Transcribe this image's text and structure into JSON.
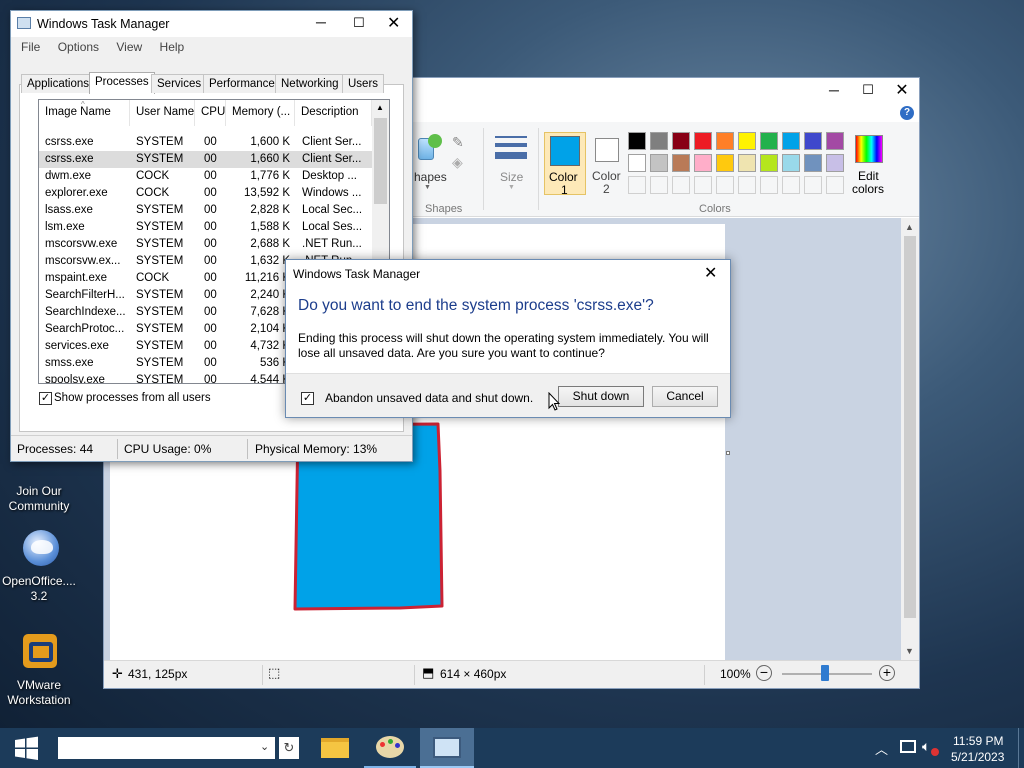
{
  "desktop": {
    "icons": [
      {
        "label_line1": "Join Our",
        "label_line2": "Community",
        "icon": "community-icon"
      },
      {
        "label_line1": "OpenOffice....",
        "label_line2": "3.2",
        "icon": "openoffice-icon"
      },
      {
        "label_line1": "VMware",
        "label_line2": "Workstation",
        "icon": "vmware-icon"
      }
    ]
  },
  "paint": {
    "ribbon": {
      "shapes_label": "hapes",
      "shapes_group": "Shapes",
      "size_label": "Size",
      "color1_line1": "Color",
      "color1_line2": "1",
      "color2_line1": "Color",
      "color2_line2": "2",
      "edit_line1": "Edit",
      "edit_line2": "colors",
      "colors_group": "Colors"
    },
    "palette_row1": [
      "#000000",
      "#7f7f7f",
      "#880015",
      "#ed1c24",
      "#ff7f27",
      "#fff200",
      "#22b14c",
      "#00a2e8",
      "#3f48cc",
      "#a349a4"
    ],
    "palette_row2": [
      "#ffffff",
      "#c3c3c3",
      "#b97a57",
      "#ffaec9",
      "#ffc90e",
      "#efe4b0",
      "#b5e61d",
      "#99d9ea",
      "#7092be",
      "#c8bfe7"
    ],
    "color1": "#00a2e8",
    "color2": "#ffffff",
    "status": {
      "cursor_pos": "431, 125px",
      "canvas_size": "614 × 460px",
      "zoom": "100%"
    },
    "zoom_level_percent": 100
  },
  "taskmanager": {
    "title": "Windows Task Manager",
    "menu": [
      "File",
      "Options",
      "View",
      "Help"
    ],
    "tabs": [
      "Applications",
      "Processes",
      "Services",
      "Performance",
      "Networking",
      "Users"
    ],
    "active_tab": "Processes",
    "columns": [
      "Image Name",
      "User Name",
      "CPU",
      "Memory (...",
      "Description"
    ],
    "rows": [
      [
        "csrss.exe",
        "SYSTEM",
        "00",
        "1,600 K",
        "Client Ser..."
      ],
      [
        "csrss.exe",
        "SYSTEM",
        "00",
        "1,660 K",
        "Client Ser..."
      ],
      [
        "dwm.exe",
        "COCK",
        "00",
        "1,776 K",
        "Desktop ..."
      ],
      [
        "explorer.exe",
        "COCK",
        "00",
        "13,592 K",
        "Windows ..."
      ],
      [
        "lsass.exe",
        "SYSTEM",
        "00",
        "2,828 K",
        "Local Sec..."
      ],
      [
        "lsm.exe",
        "SYSTEM",
        "00",
        "1,588 K",
        "Local Ses..."
      ],
      [
        "mscorsvw.exe",
        "SYSTEM",
        "00",
        "2,688 K",
        ".NET Run..."
      ],
      [
        "mscorsvw.ex...",
        "SYSTEM",
        "00",
        "1,632 K",
        ".NET Run..."
      ],
      [
        "mspaint.exe",
        "COCK",
        "00",
        "11,216 K",
        ""
      ],
      [
        "SearchFilterH...",
        "SYSTEM",
        "00",
        "2,240 K",
        ""
      ],
      [
        "SearchIndexe...",
        "SYSTEM",
        "00",
        "7,628 K",
        ""
      ],
      [
        "SearchProtoc...",
        "SYSTEM",
        "00",
        "2,104 K",
        ""
      ],
      [
        "services.exe",
        "SYSTEM",
        "00",
        "4,732 K",
        ""
      ],
      [
        "smss.exe",
        "SYSTEM",
        "00",
        "536 K",
        ""
      ],
      [
        "spoolsv.exe",
        "SYSTEM",
        "00",
        "4,544 K",
        ""
      ]
    ],
    "selected_row": 1,
    "show_all_label": "Show processes from all users",
    "status": {
      "processes": "Processes: 44",
      "cpu": "CPU Usage: 0%",
      "memory": "Physical Memory: 13%"
    }
  },
  "dialog": {
    "title": "Windows Task Manager",
    "heading": "Do you want to end the system process 'csrss.exe'?",
    "body_line1": "Ending this process will shut down the operating system immediately.  You will",
    "body_line2": "lose all unsaved data.  Are you sure you want to continue?",
    "checkbox_label": "Abandon unsaved data and shut down.",
    "checkbox_checked": true,
    "shutdown_label": "Shut down",
    "cancel_label": "Cancel"
  },
  "taskbar": {
    "time": "11:59 PM",
    "date": "5/21/2023",
    "accent": "#1c3b5a"
  }
}
